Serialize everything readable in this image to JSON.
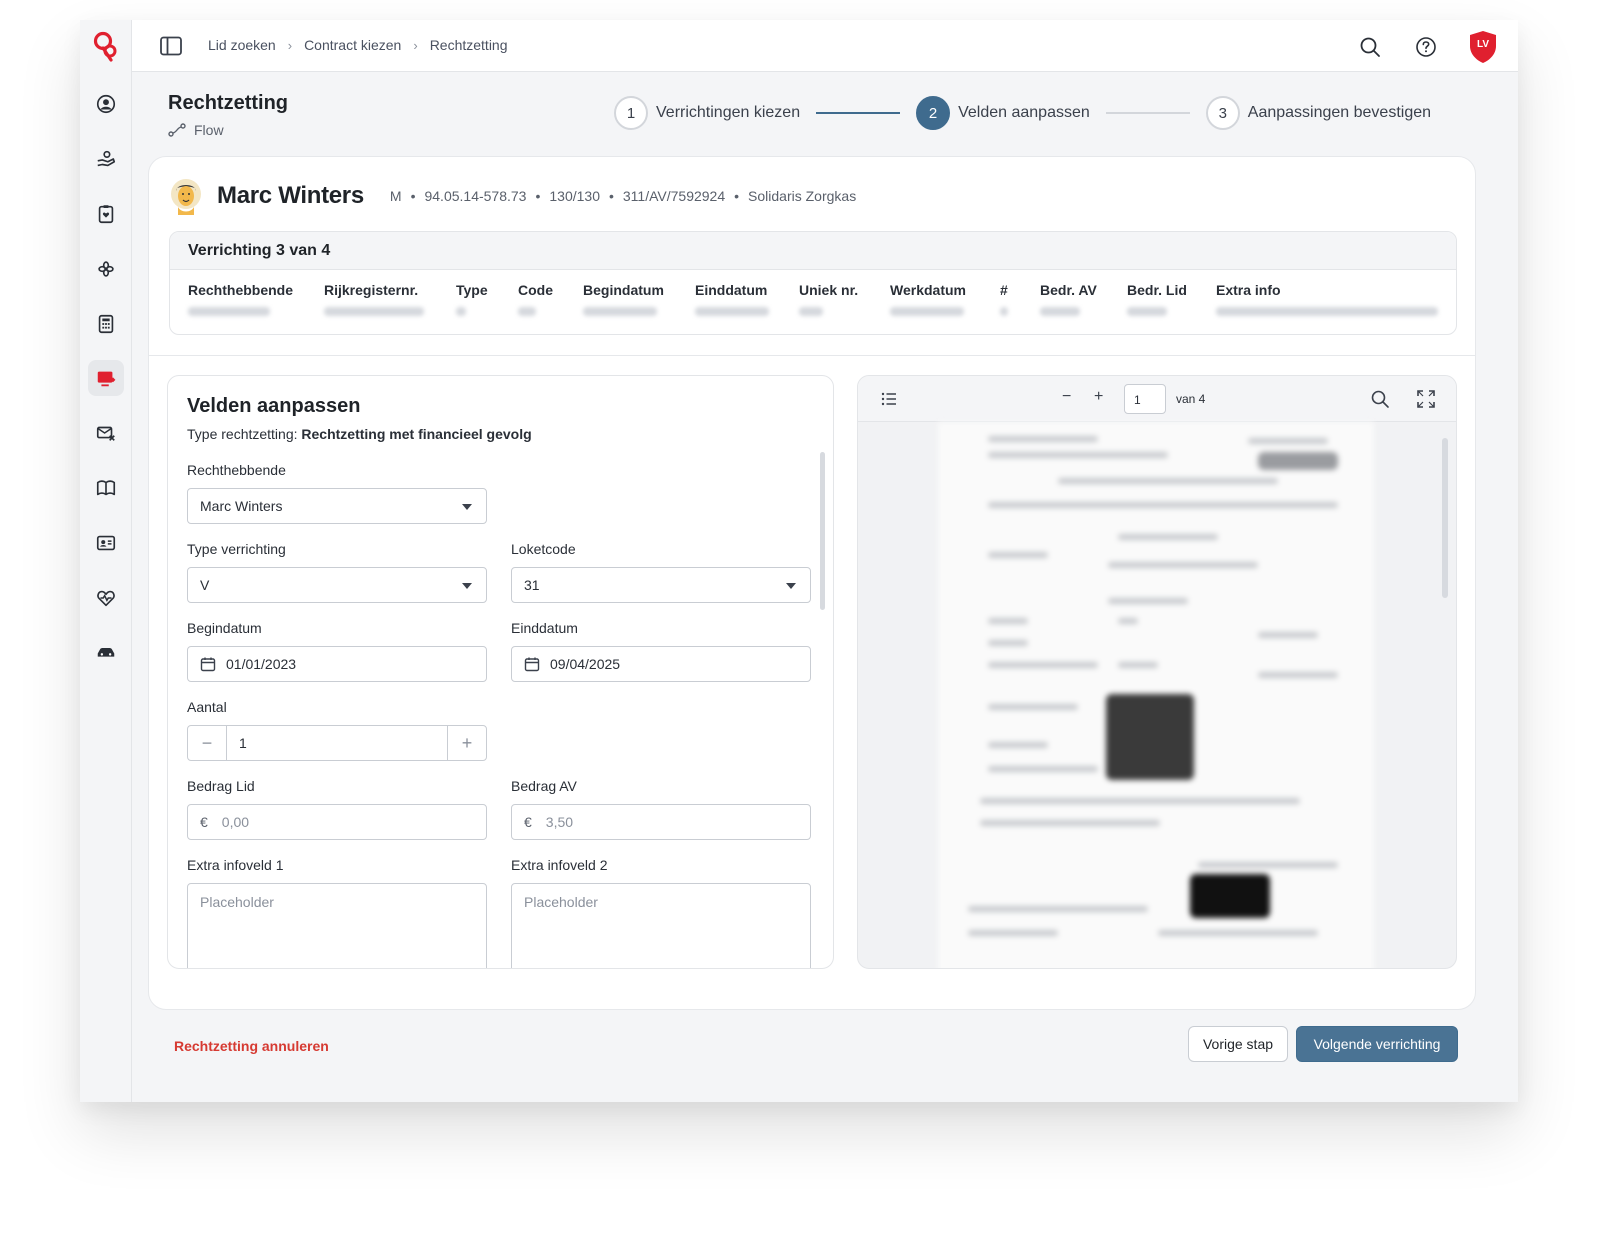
{
  "topbar": {
    "breadcrumbs": [
      "Lid zoeken",
      "Contract kiezen",
      "Rechtzetting"
    ],
    "avatar_initials": "LV"
  },
  "page": {
    "title": "Rechtzetting",
    "subtitle": "Flow"
  },
  "stepper": {
    "steps": [
      {
        "num": "1",
        "label": "Verrichtingen kiezen",
        "state": "done"
      },
      {
        "num": "2",
        "label": "Velden aanpassen",
        "state": "active"
      },
      {
        "num": "3",
        "label": "Aanpassingen bevestigen",
        "state": "todo"
      }
    ]
  },
  "member": {
    "name": "Marc Winters",
    "gender": "M",
    "national_id": "94.05.14-578.73",
    "code": "130/130",
    "reference": "311/AV/7592924",
    "fund": "Solidaris Zorgkas"
  },
  "verrichting": {
    "title": "Verrichting 3 van 4",
    "columns": [
      "Rechthebbende",
      "Rijkregisternr.",
      "Type",
      "Code",
      "Begindatum",
      "Einddatum",
      "Uniek nr.",
      "Werkdatum",
      "#",
      "Bedr. AV",
      "Bedr. Lid",
      "Extra info"
    ]
  },
  "form": {
    "title": "Velden aanpassen",
    "type_label": "Type rechtzetting:",
    "type_value": "Rechtzetting met financieel gevolg",
    "rechthebbende": {
      "label": "Rechthebbende",
      "value": "Marc Winters"
    },
    "type_verrichting": {
      "label": "Type verrichting",
      "value": "V"
    },
    "loketcode": {
      "label": "Loketcode",
      "value": "31"
    },
    "begindatum": {
      "label": "Begindatum",
      "value": "01/01/2023"
    },
    "einddatum": {
      "label": "Einddatum",
      "value": "09/04/2025"
    },
    "aantal": {
      "label": "Aantal",
      "value": "1",
      "minus": "−",
      "plus": "+"
    },
    "bedrag_lid": {
      "label": "Bedrag Lid",
      "currency": "€",
      "placeholder": "0,00"
    },
    "bedrag_av": {
      "label": "Bedrag AV",
      "currency": "€",
      "placeholder": "3,50"
    },
    "extra1": {
      "label": "Extra infoveld 1",
      "placeholder": "Placeholder"
    },
    "extra2": {
      "label": "Extra infoveld 2",
      "placeholder": "Placeholder"
    }
  },
  "viewer": {
    "page": "1",
    "of": "van 4",
    "zoom_out": "−",
    "zoom_in": "+"
  },
  "footer": {
    "cancel": "Rechtzetting annuleren",
    "prev": "Vorige stap",
    "next": "Volgende verrichting"
  },
  "colors": {
    "brand_red": "#e0202f",
    "primary_blue": "#4a7394",
    "danger": "#d63a32"
  },
  "icons": {
    "rail": [
      "logo-icon",
      "user-circle-icon",
      "hand-coin-icon",
      "clipboard-heart-icon",
      "asterisk-icon",
      "calculator-icon",
      "inbox-arrow-icon",
      "mail-x-icon",
      "book-icon",
      "id-card-icon",
      "heart-pulse-icon",
      "car-icon"
    ]
  }
}
